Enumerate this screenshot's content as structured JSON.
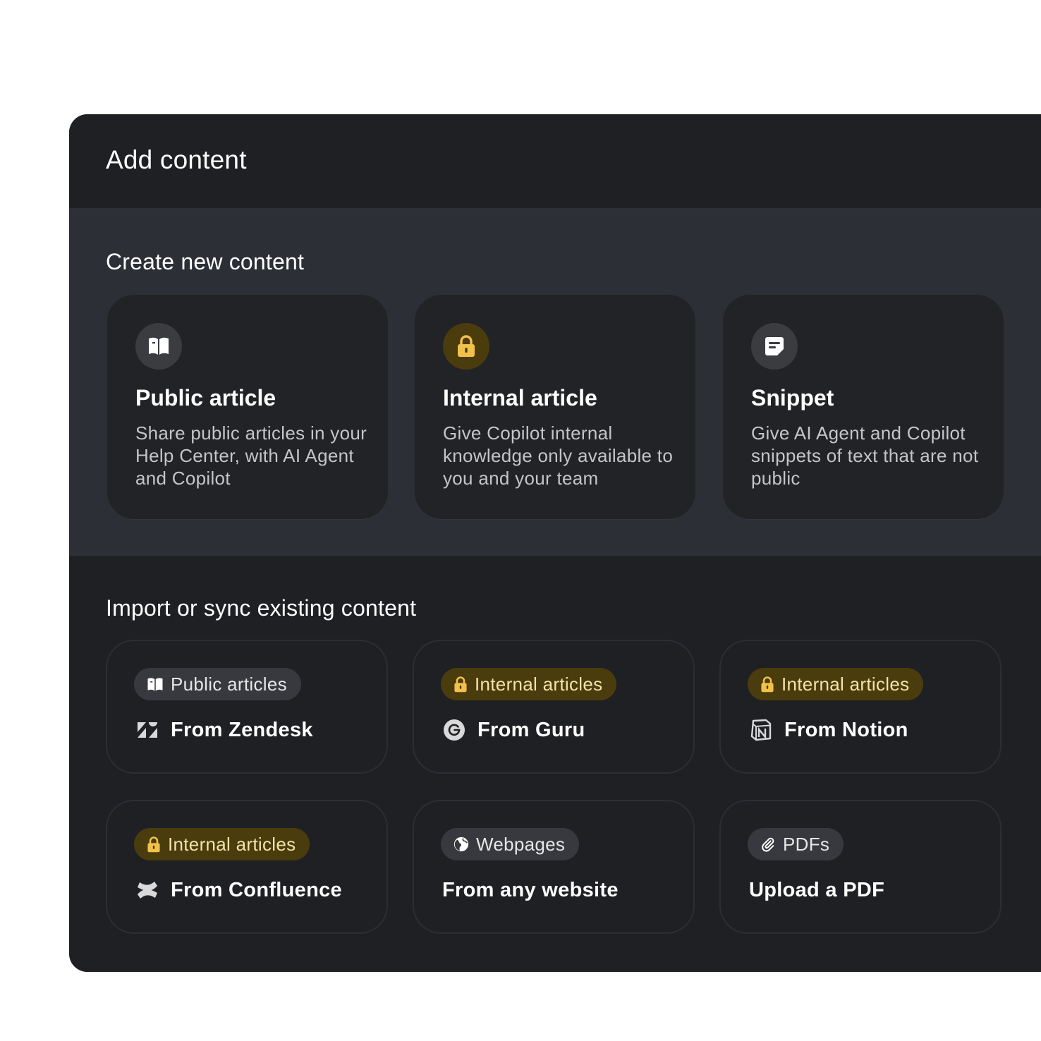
{
  "title": "Add content",
  "create": {
    "heading": "Create new content",
    "cards": [
      {
        "icon": "book-icon",
        "title": "Public article",
        "description": "Share public articles in your Help Center, with AI Agent and Copilot"
      },
      {
        "icon": "lock-icon",
        "title": "Internal article",
        "description": "Give Copilot internal knowledge only available to you and your team"
      },
      {
        "icon": "snippet-icon",
        "title": "Snippet",
        "description": "Give AI Agent and Copilot snippets of text that are not public"
      }
    ]
  },
  "import": {
    "heading": "Import or sync existing content",
    "cards": [
      {
        "pill": "Public articles",
        "pill_icon": "book-icon",
        "source": "From Zendesk",
        "source_icon": "zendesk-logo-icon"
      },
      {
        "pill": "Internal articles",
        "pill_icon": "lock-icon",
        "source": "From Guru",
        "source_icon": "guru-logo-icon"
      },
      {
        "pill": "Internal articles",
        "pill_icon": "lock-icon",
        "source": "From Notion",
        "source_icon": "notion-logo-icon"
      },
      {
        "pill": "Internal articles",
        "pill_icon": "lock-icon",
        "source": "From Confluence",
        "source_icon": "confluence-logo-icon"
      },
      {
        "pill": "Webpages",
        "pill_icon": "globe-icon",
        "source": "From any website"
      },
      {
        "pill": "PDFs",
        "pill_icon": "paperclip-icon",
        "source": "Upload a PDF"
      }
    ]
  },
  "colors": {
    "panel": "#1f2024",
    "create_band": "#2d2f36",
    "card": "#222326",
    "gold_badge": "#4a3c0d",
    "gold_text": "#f4e2a8",
    "gold_icon": "#f2c14b"
  }
}
